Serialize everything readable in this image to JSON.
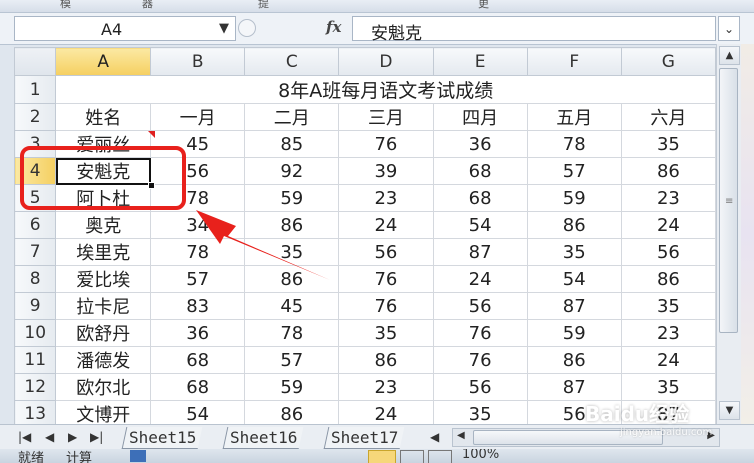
{
  "ribbon": {
    "tabs": [
      "模",
      "器",
      "提",
      "更"
    ]
  },
  "formula_bar": {
    "name_box": "A4",
    "fx_label": "fx",
    "formula": "安魁克"
  },
  "grid": {
    "columns": [
      "A",
      "B",
      "C",
      "D",
      "E",
      "F",
      "G"
    ],
    "rows": [
      "1",
      "2",
      "3",
      "4",
      "5",
      "6",
      "7",
      "8",
      "9",
      "10",
      "11",
      "12",
      "13"
    ],
    "title": "8年A班每月语文考试成绩",
    "headers": [
      "姓名",
      "一月",
      "二月",
      "三月",
      "四月",
      "五月",
      "六月"
    ],
    "data": [
      [
        "爱丽丝",
        "45",
        "85",
        "76",
        "36",
        "78",
        "35"
      ],
      [
        "安魁克",
        "56",
        "92",
        "39",
        "68",
        "57",
        "86"
      ],
      [
        "阿卜杜",
        "78",
        "59",
        "23",
        "68",
        "59",
        "23"
      ],
      [
        "奥克",
        "34",
        "86",
        "24",
        "54",
        "86",
        "24"
      ],
      [
        "埃里克",
        "78",
        "35",
        "56",
        "87",
        "35",
        "56"
      ],
      [
        "爱比埃",
        "57",
        "86",
        "76",
        "24",
        "54",
        "86"
      ],
      [
        "拉卡尼",
        "83",
        "45",
        "76",
        "56",
        "87",
        "35"
      ],
      [
        "欧舒丹",
        "36",
        "78",
        "35",
        "76",
        "59",
        "23"
      ],
      [
        "潘德发",
        "68",
        "57",
        "86",
        "76",
        "86",
        "24"
      ],
      [
        "欧尔北",
        "68",
        "59",
        "23",
        "56",
        "87",
        "35"
      ],
      [
        "文博开",
        "54",
        "86",
        "24",
        "35",
        "56",
        "87"
      ]
    ],
    "active_cell": "A4"
  },
  "sheet_tabs": [
    "Sheet15",
    "Sheet16",
    "Sheet17"
  ],
  "status_bar": {
    "ready": "就绪",
    "calc": "计算",
    "zoom": "100%"
  },
  "watermark": {
    "text": "Baidu经验",
    "url": "jingyan.baidu.com"
  },
  "colors": {
    "annotation": "#e8211c",
    "active_header": "#f5cf61"
  }
}
